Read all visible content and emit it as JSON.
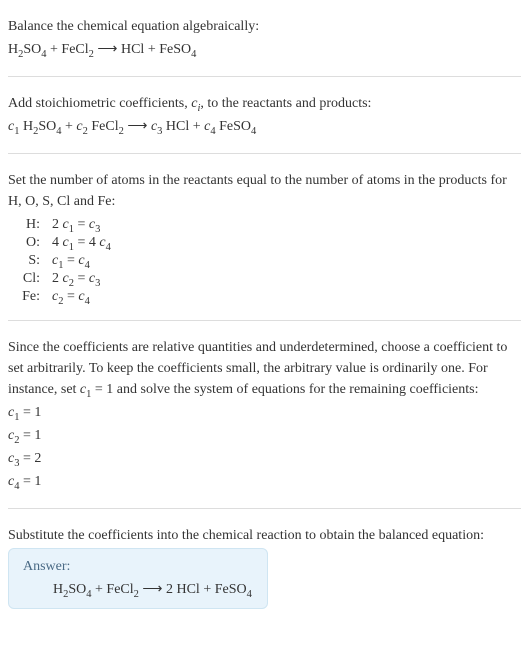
{
  "intro": {
    "line1": "Balance the chemical equation algebraically:",
    "eq_parts": [
      "H",
      "2",
      "SO",
      "4",
      " + FeCl",
      "2",
      " ⟶ HCl + FeSO",
      "4"
    ]
  },
  "stoich": {
    "line1_a": "Add stoichiometric coefficients, ",
    "line1_c": "c",
    "line1_i": "i",
    "line1_b": ", to the reactants and products:",
    "eq_parts": [
      "c",
      "1",
      " H",
      "2",
      "SO",
      "4",
      " + ",
      "c",
      "2",
      " FeCl",
      "2",
      " ⟶ ",
      "c",
      "3",
      " HCl + ",
      "c",
      "4",
      " FeSO",
      "4"
    ]
  },
  "atoms": {
    "intro": "Set the number of atoms in the reactants equal to the number of atoms in the products for H, O, S, Cl and Fe:",
    "rows": [
      {
        "label": "H:",
        "lhs_n": "2",
        "lhs_c": "c",
        "lhs_i": "1",
        "rhs_c": "c",
        "rhs_i": "3",
        "rhs_pre": "",
        "rhs_post": ""
      },
      {
        "label": "O:",
        "lhs_n": "4",
        "lhs_c": "c",
        "lhs_i": "1",
        "rhs_pre": "4",
        "rhs_c": "c",
        "rhs_i": "4",
        "rhs_post": ""
      },
      {
        "label": "S:",
        "lhs_n": "",
        "lhs_c": "c",
        "lhs_i": "1",
        "rhs_pre": "",
        "rhs_c": "c",
        "rhs_i": "4",
        "rhs_post": ""
      },
      {
        "label": "Cl:",
        "lhs_n": "2",
        "lhs_c": "c",
        "lhs_i": "2",
        "rhs_pre": "",
        "rhs_c": "c",
        "rhs_i": "3",
        "rhs_post": ""
      },
      {
        "label": "Fe:",
        "lhs_n": "",
        "lhs_c": "c",
        "lhs_i": "2",
        "rhs_pre": "",
        "rhs_c": "c",
        "rhs_i": "4",
        "rhs_post": ""
      }
    ]
  },
  "choose": {
    "intro_a": "Since the coefficients are relative quantities and underdetermined, choose a coefficient to set arbitrarily. To keep the coefficients small, the arbitrary value is ordinarily one. For instance, set ",
    "intro_c": "c",
    "intro_i": "1",
    "intro_b": " = 1 and solve the system of equations for the remaining coefficients:",
    "lines": [
      {
        "c": "c",
        "i": "1",
        "eq": " = 1"
      },
      {
        "c": "c",
        "i": "2",
        "eq": " = 1"
      },
      {
        "c": "c",
        "i": "3",
        "eq": " = 2"
      },
      {
        "c": "c",
        "i": "4",
        "eq": " = 1"
      }
    ]
  },
  "final": {
    "intro": "Substitute the coefficients into the chemical reaction to obtain the balanced equation:",
    "answer_label": "Answer:",
    "eq_parts": [
      "H",
      "2",
      "SO",
      "4",
      " + FeCl",
      "2",
      " ⟶ 2 HCl + FeSO",
      "4"
    ]
  },
  "chart_data": {
    "type": "table",
    "title": "Atom balance equations",
    "rows": [
      {
        "element": "H",
        "equation": "2 c1 = c3"
      },
      {
        "element": "O",
        "equation": "4 c1 = 4 c4"
      },
      {
        "element": "S",
        "equation": "c1 = c4"
      },
      {
        "element": "Cl",
        "equation": "2 c2 = c3"
      },
      {
        "element": "Fe",
        "equation": "c2 = c4"
      }
    ],
    "solution": {
      "c1": 1,
      "c2": 1,
      "c3": 2,
      "c4": 1
    },
    "balanced_equation": "H2SO4 + FeCl2 ⟶ 2 HCl + FeSO4"
  }
}
